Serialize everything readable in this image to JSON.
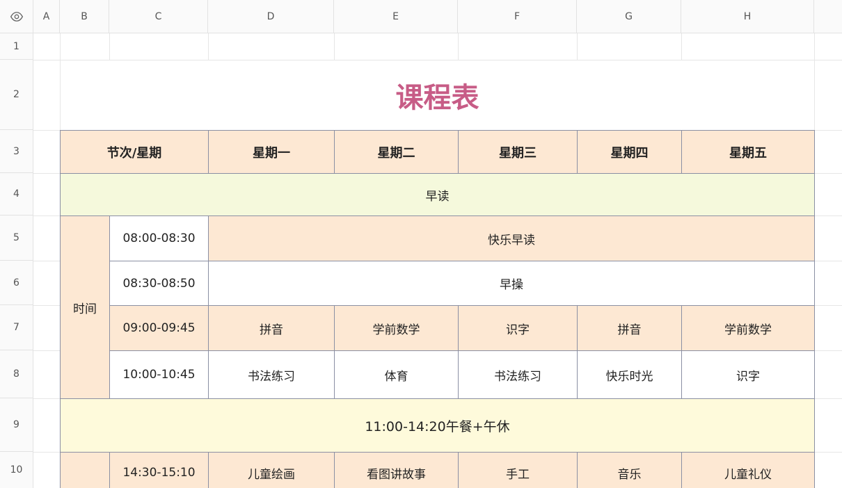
{
  "columns": [
    "A",
    "B",
    "C",
    "D",
    "E",
    "F",
    "G",
    "H"
  ],
  "rows": [
    "1",
    "2",
    "3",
    "4",
    "5",
    "6",
    "7",
    "8",
    "9",
    "10"
  ],
  "title": "课程表",
  "header": {
    "corner": "节次/星期",
    "days": [
      "星期一",
      "星期二",
      "星期三",
      "星期四",
      "星期五"
    ]
  },
  "morning_reading": "早读",
  "time_label": "时间",
  "slots": [
    {
      "time": "08:00-08:30",
      "merged": "快乐早读"
    },
    {
      "time": "08:30-08:50",
      "merged": "早操"
    },
    {
      "time": "09:00-09:45",
      "classes": [
        "拼音",
        "学前数学",
        "识字",
        "拼音",
        "学前数学"
      ]
    },
    {
      "time": "10:00-10:45",
      "classes": [
        "书法练习",
        "体育",
        "书法练习",
        "快乐时光",
        "识字"
      ]
    }
  ],
  "lunch": "11:00-14:20午餐+午休",
  "afternoon": [
    {
      "time": "14:30-15:10",
      "classes": [
        "儿童绘画",
        "看图讲故事",
        "手工",
        "音乐",
        "儿童礼仪"
      ]
    }
  ],
  "colors": {
    "title": "#c75c86",
    "peach": "#fde8d3",
    "lime": "#f5f9dc",
    "cream": "#fefadb",
    "border": "#8a8fa3"
  },
  "icons": {
    "corner": "eye-icon"
  }
}
